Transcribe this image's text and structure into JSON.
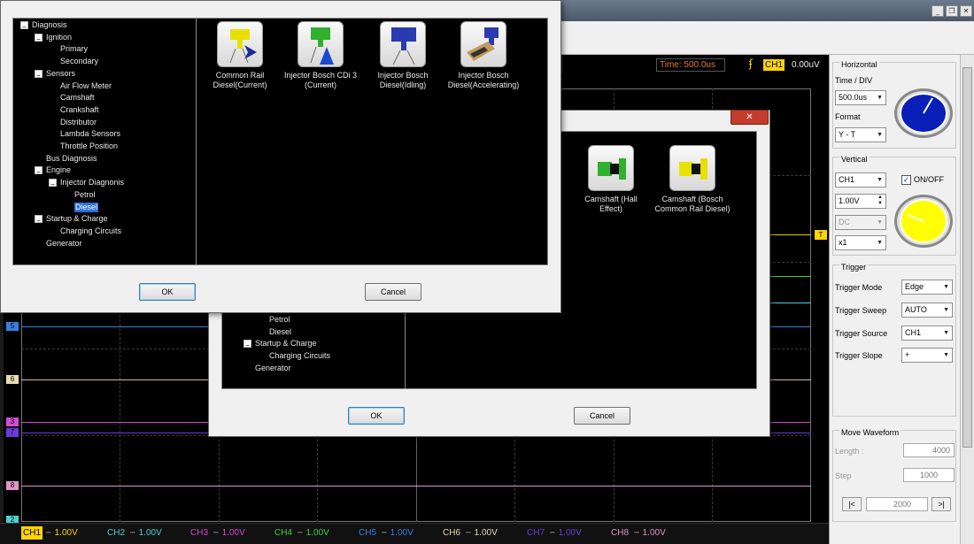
{
  "window": {
    "buttons": [
      "_",
      "❐",
      "✕"
    ]
  },
  "status": {
    "time": "Time: 500.0us",
    "trigger_channel": "CH1",
    "trigger_value": "0.00uV"
  },
  "scope": {
    "markers": [
      "5",
      "6",
      "3",
      "7",
      "8",
      "2"
    ],
    "trigger_marker": "T"
  },
  "channels": [
    {
      "name": "CH1",
      "volt": "1.00V",
      "color": "#ffd400"
    },
    {
      "name": "CH2",
      "volt": "1.00V",
      "color": "#4fd0d0"
    },
    {
      "name": "CH3",
      "volt": "1.00V",
      "color": "#d34ad3"
    },
    {
      "name": "CH4",
      "volt": "1.00V",
      "color": "#3cd23c"
    },
    {
      "name": "CH5",
      "volt": "1.00V",
      "color": "#3a7fe0"
    },
    {
      "name": "CH6",
      "volt": "1.00V",
      "color": "#e8dcb0"
    },
    {
      "name": "CH7",
      "volt": "1.00V",
      "color": "#6a3cd8"
    },
    {
      "name": "CH8",
      "volt": "1.00V",
      "color": "#e096c8"
    }
  ],
  "panel": {
    "horizontal": {
      "title": "Horizontal",
      "time_div_label": "Time / DIV",
      "time_div_value": "500.0us",
      "format_label": "Format",
      "format_value": "Y - T",
      "knob_color": "#0a1fb8"
    },
    "vertical": {
      "title": "Vertical",
      "channel": "CH1",
      "onoff_label": "ON/OFF",
      "onoff_checked": true,
      "volt": "1.00V",
      "coupling": "DC",
      "probe": "x1",
      "knob_color": "#ffff00"
    },
    "trigger": {
      "title": "Trigger",
      "mode_label": "Trigger Mode",
      "mode_value": "Edge",
      "sweep_label": "Trigger Sweep",
      "sweep_value": "AUTO",
      "source_label": "Trigger Source",
      "source_value": "CH1",
      "slope_label": "Trigger Slope",
      "slope_value": "+"
    },
    "move": {
      "title": "Move Waveform",
      "length_label": "Length :",
      "length_value": "4000",
      "step_label": "Step",
      "step_value": "1000",
      "pos_value": "2000",
      "first_btn": "|<",
      "last_btn": ">|"
    }
  },
  "dialog_front": {
    "tree": [
      {
        "label": "Diagnosis",
        "pm": "−"
      },
      {
        "label": "Ignition",
        "pm": "−"
      },
      {
        "label": "Primary"
      },
      {
        "label": "Secondary"
      },
      {
        "label": "Sensors",
        "pm": "−"
      },
      {
        "label": "Air Flow Meter"
      },
      {
        "label": "Camshaft"
      },
      {
        "label": "Crankshaft"
      },
      {
        "label": "Distributor"
      },
      {
        "label": "Lambda Sensors"
      },
      {
        "label": "Throttle Position"
      },
      {
        "label": "Bus Diagnosis"
      },
      {
        "label": "Engine",
        "pm": "−"
      },
      {
        "label": "Injector Diagnonis",
        "pm": "−"
      },
      {
        "label": "Petrol"
      },
      {
        "label": "Diesel",
        "selected": true
      },
      {
        "label": "Startup & Charge",
        "pm": "−"
      },
      {
        "label": "Charging Circuits"
      },
      {
        "label": "Generator"
      }
    ],
    "items": [
      {
        "line1": "Common Rail",
        "line2": "Diesel(Current)"
      },
      {
        "line1": "Injector Bosch CDi 3",
        "line2": "(Current)"
      },
      {
        "line1": "Injector Bosch",
        "line2": "Diesel(Idling)"
      },
      {
        "line1": "Injector Bosch",
        "line2": "Diesel(Accelerating)"
      }
    ],
    "ok_label": "OK",
    "cancel_label": "Cancel"
  },
  "dialog_back": {
    "close_label": "✕",
    "tree": [
      {
        "label": "Petrol"
      },
      {
        "label": "Diesel"
      },
      {
        "label": "Startup & Charge",
        "pm": "−"
      },
      {
        "label": "Charging Circuits"
      },
      {
        "label": "Generator"
      }
    ],
    "items": [
      {
        "line1": "Camshaft (Hall",
        "line2": "Effect)"
      },
      {
        "line1": "Camshaft (Bosch",
        "line2": "Common Rail Diesel)"
      }
    ],
    "ok_label": "OK",
    "cancel_label": "Cancel"
  }
}
